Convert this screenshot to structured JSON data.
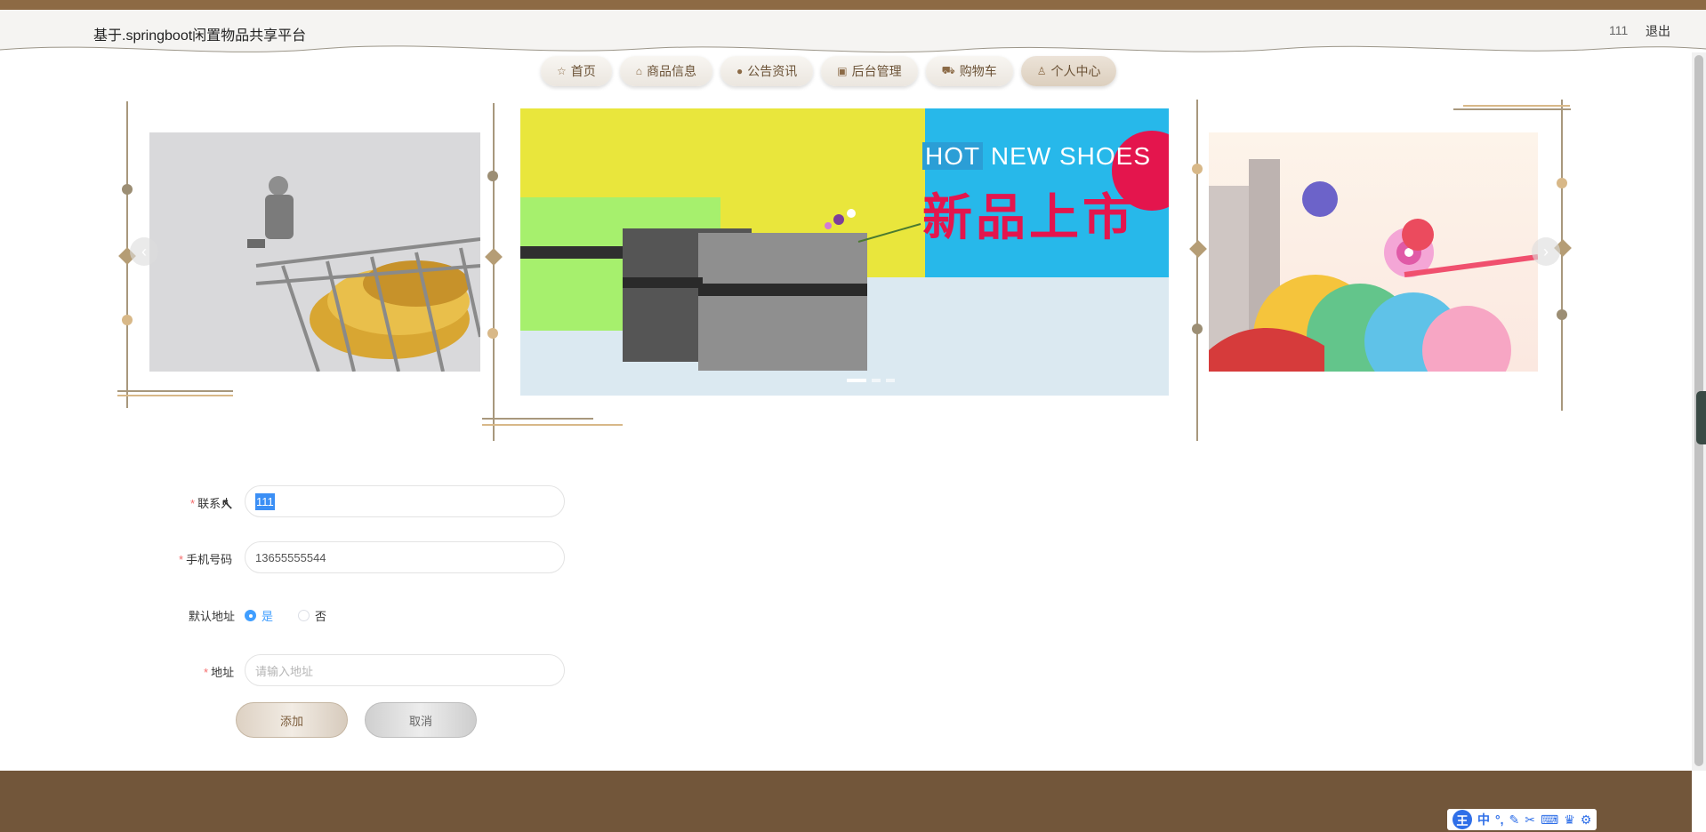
{
  "header": {
    "title": "基于.springboot闲置物品共享平台",
    "username": "111",
    "logout": "退出"
  },
  "nav": {
    "items": [
      {
        "label": "首页",
        "icon": "star-icon"
      },
      {
        "label": "商品信息",
        "icon": "bag-icon"
      },
      {
        "label": "公告资讯",
        "icon": "info-icon"
      },
      {
        "label": "后台管理",
        "icon": "briefcase-icon"
      },
      {
        "label": "购物车",
        "icon": "cart-icon"
      },
      {
        "label": "个人中心",
        "icon": "user-icon"
      }
    ],
    "active_index": 5
  },
  "carousel": {
    "promo_hot": "HOT",
    "promo_new_shoes": "NEW SHOES",
    "promo_cn": "新品上市",
    "slide_count": 3,
    "active_slide": 0
  },
  "form": {
    "contact_label": "联系人",
    "contact_value": "111",
    "phone_label": "手机号码",
    "phone_value": "13655555544",
    "default_label": "默认地址",
    "default_yes": "是",
    "default_no": "否",
    "address_label": "地址",
    "address_placeholder": "请输入地址",
    "add_button": "添加",
    "cancel_button": "取消"
  },
  "ime": {
    "logo": "王",
    "lang": "中"
  },
  "colors": {
    "brand": "#8d6a44",
    "footer": "#72563a",
    "radio_active": "#409eff",
    "required": "#f56c6c"
  }
}
